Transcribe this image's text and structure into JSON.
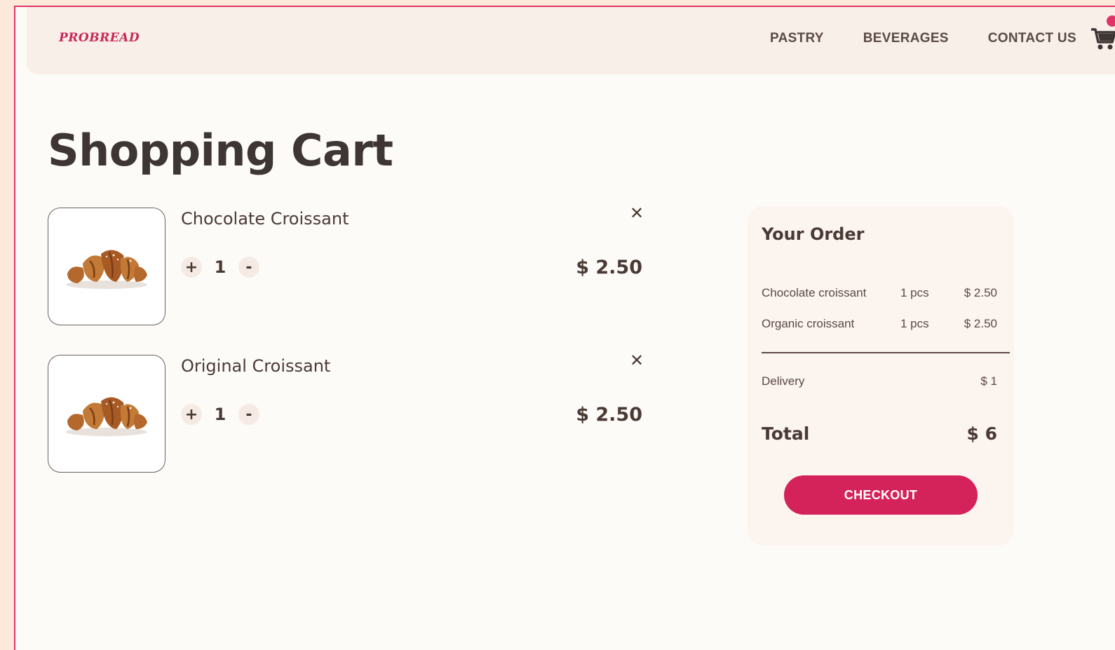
{
  "brand": {
    "logo": "PROBREAD",
    "accent_color": "#d4225b"
  },
  "nav": {
    "links": [
      {
        "label": "PASTRY"
      },
      {
        "label": "BEVERAGES"
      },
      {
        "label": "CONTACT US"
      }
    ],
    "cart_icon": "shopping-cart-icon"
  },
  "page": {
    "title": "Shopping Cart"
  },
  "cart": {
    "items": [
      {
        "name": "Chocolate Croissant",
        "quantity": "1",
        "price": "$ 2.50",
        "plus_label": "+",
        "minus_label": "-",
        "remove_icon": "close-icon"
      },
      {
        "name": "Original Croissant",
        "quantity": "1",
        "price": "$ 2.50",
        "plus_label": "+",
        "minus_label": "-",
        "remove_icon": "close-icon"
      }
    ]
  },
  "order": {
    "title": "Your Order",
    "lines": [
      {
        "name": "Chocolate croissant",
        "qty": "1 pcs",
        "price": "$ 2.50"
      },
      {
        "name": "Organic croissant",
        "qty": "1 pcs",
        "price": "$ 2.50"
      }
    ],
    "delivery_label": "Delivery",
    "delivery_value": "$ 1",
    "total_label": "Total",
    "total_value": "$ 6",
    "checkout_label": "CHECKOUT"
  }
}
